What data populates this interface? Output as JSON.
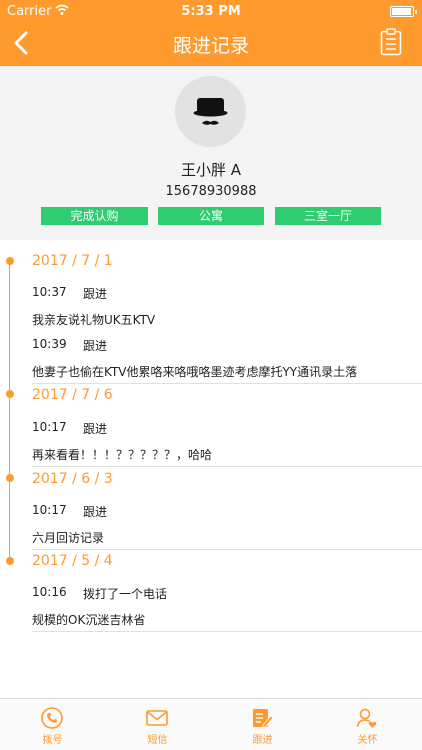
{
  "status_bar": {
    "carrier": "Carrier",
    "time": "5:33 PM"
  },
  "nav": {
    "title": "跟进记录"
  },
  "profile": {
    "name": "王小胖  A",
    "phone": "15678930988",
    "tags": [
      "完成认购",
      "公寓",
      "三室一厅"
    ]
  },
  "timeline": [
    {
      "date": "2017 / 7 / 1",
      "entries": [
        {
          "time": "10:37",
          "type": "跟进",
          "content": "我亲友说礼物UK五KTV"
        },
        {
          "time": "10:39",
          "type": "跟进",
          "content": "他妻子也偷在KTV他累咯来咯哦咯墨迹考虑摩托YY通讯录土落"
        }
      ]
    },
    {
      "date": "2017 / 7 / 6",
      "entries": [
        {
          "time": "10:17",
          "type": "跟进",
          "content": "再来看看！！！？？？？？，哈哈"
        }
      ]
    },
    {
      "date": "2017 / 6 / 3",
      "entries": [
        {
          "time": "10:17",
          "type": "跟进",
          "content": "六月回访记录"
        }
      ]
    },
    {
      "date": "2017 / 5 / 4",
      "entries": [
        {
          "time": "10:16",
          "type": "拨打了一个电话",
          "content": "规模的OK沉迷吉林省"
        }
      ]
    }
  ],
  "tabbar": {
    "items": [
      {
        "label": "拨号",
        "icon": "phone-icon"
      },
      {
        "label": "短信",
        "icon": "mail-icon"
      },
      {
        "label": "跟进",
        "icon": "edit-icon"
      },
      {
        "label": "关怀",
        "icon": "user-heart-icon"
      }
    ],
    "accent": "#ff9a2e"
  },
  "colors": {
    "primary": "#ff9a2e",
    "tag": "#2fcc71"
  }
}
